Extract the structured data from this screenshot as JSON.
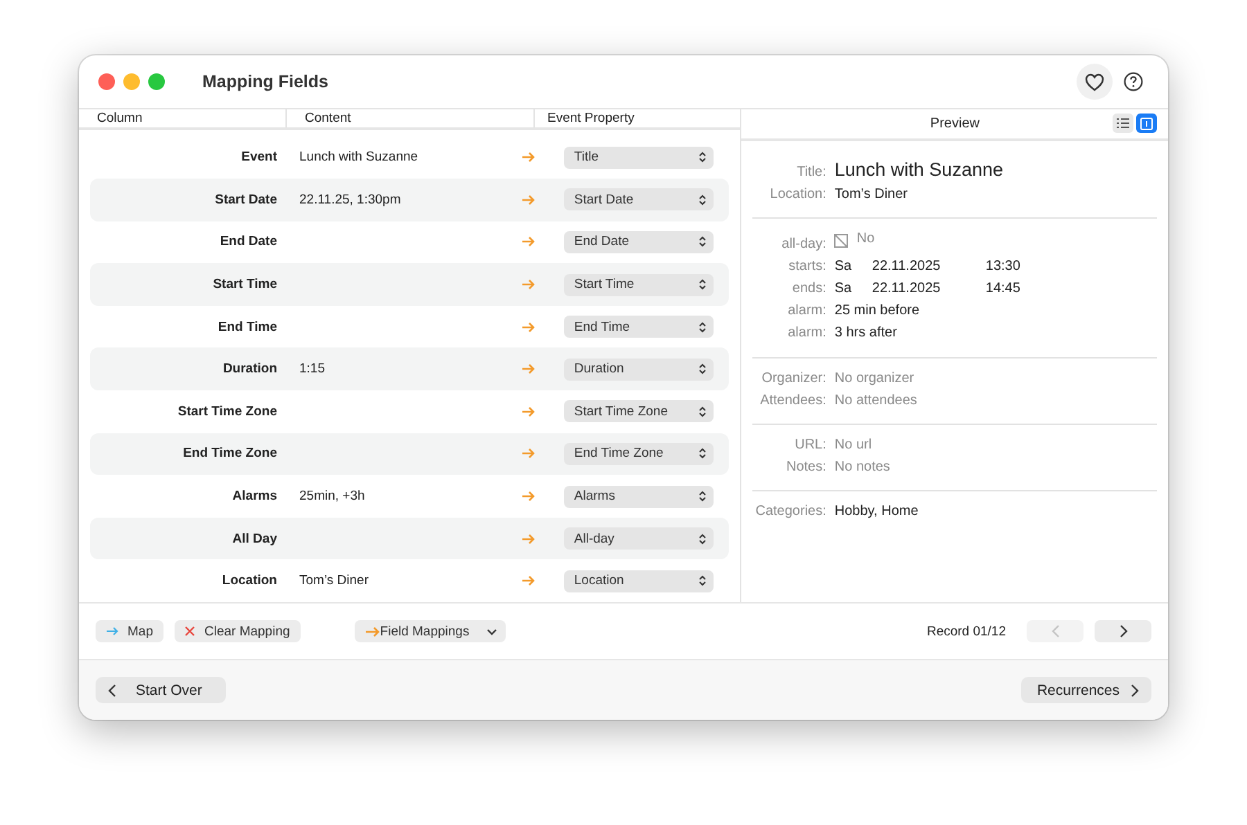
{
  "window": {
    "title": "Mapping Fields"
  },
  "table": {
    "columns": [
      "Column",
      "Content",
      "Event Property"
    ],
    "rows": [
      {
        "column": "Event",
        "content": "Lunch with Suzanne",
        "property": "Title"
      },
      {
        "column": "Start Date",
        "content": "22.11.25, 1:30pm",
        "property": "Start Date"
      },
      {
        "column": "End Date",
        "content": "",
        "property": "End Date"
      },
      {
        "column": "Start Time",
        "content": "",
        "property": "Start Time"
      },
      {
        "column": "End Time",
        "content": "",
        "property": "End Time"
      },
      {
        "column": "Duration",
        "content": "1:15",
        "property": "Duration"
      },
      {
        "column": "Start Time Zone",
        "content": "",
        "property": "Start Time Zone"
      },
      {
        "column": "End Time Zone",
        "content": "",
        "property": "End Time Zone"
      },
      {
        "column": "Alarms",
        "content": "25min, +3h",
        "property": "Alarms"
      },
      {
        "column": "All Day",
        "content": "",
        "property": "All-day"
      },
      {
        "column": "Location",
        "content": "Tom’s Diner",
        "property": "Location"
      }
    ]
  },
  "preview": {
    "title": "Preview",
    "view_buttons": [
      {
        "kind": "list",
        "selected": false
      },
      {
        "kind": "detail",
        "selected": true
      }
    ],
    "sections": [
      [
        {
          "kind": "title",
          "label": "Title:",
          "value": "Lunch with Suzanne",
          "muted": false
        },
        {
          "kind": "text",
          "label": "Location:",
          "value": "Tom’s Diner",
          "muted": false
        }
      ],
      [
        {
          "kind": "checkbox",
          "label": "all-day:",
          "value": "No",
          "checked": false,
          "muted": true
        },
        {
          "kind": "date",
          "label": "starts:",
          "parts": [
            "Sa",
            "22.11.2025",
            "13:30"
          ]
        },
        {
          "kind": "date",
          "label": "ends:",
          "parts": [
            "Sa",
            "22.11.2025",
            "14:45"
          ]
        },
        {
          "kind": "text",
          "label": "alarm:",
          "value": "25 min before",
          "muted": false
        },
        {
          "kind": "text",
          "label": "alarm:",
          "value": "3 hrs after",
          "muted": false
        }
      ],
      [
        {
          "kind": "text",
          "label": "Organizer:",
          "value": "No organizer",
          "muted": true
        },
        {
          "kind": "text",
          "label": "Attendees:",
          "value": "No attendees",
          "muted": true
        }
      ],
      [
        {
          "kind": "text",
          "label": "URL:",
          "value": "No url",
          "muted": true
        },
        {
          "kind": "text",
          "label": "Notes:",
          "value": "No notes",
          "muted": true
        }
      ],
      [
        {
          "kind": "text",
          "label": "Categories:",
          "value": "Hobby, Home",
          "muted": false
        }
      ]
    ]
  },
  "toolbar": {
    "buttons": [
      {
        "kind": "map",
        "label": "Map"
      },
      {
        "kind": "clear",
        "label": "Clear Mapping"
      }
    ],
    "menu": {
      "label": "Field Mappings"
    },
    "record": "Record 01/12",
    "nav": [
      {
        "kind": "prev",
        "disabled": true
      },
      {
        "kind": "next",
        "disabled": false
      }
    ]
  },
  "footer": {
    "buttons": [
      {
        "kind": "back",
        "label": "Start Over"
      },
      {
        "kind": "forward",
        "label": "Recurrences"
      }
    ]
  }
}
